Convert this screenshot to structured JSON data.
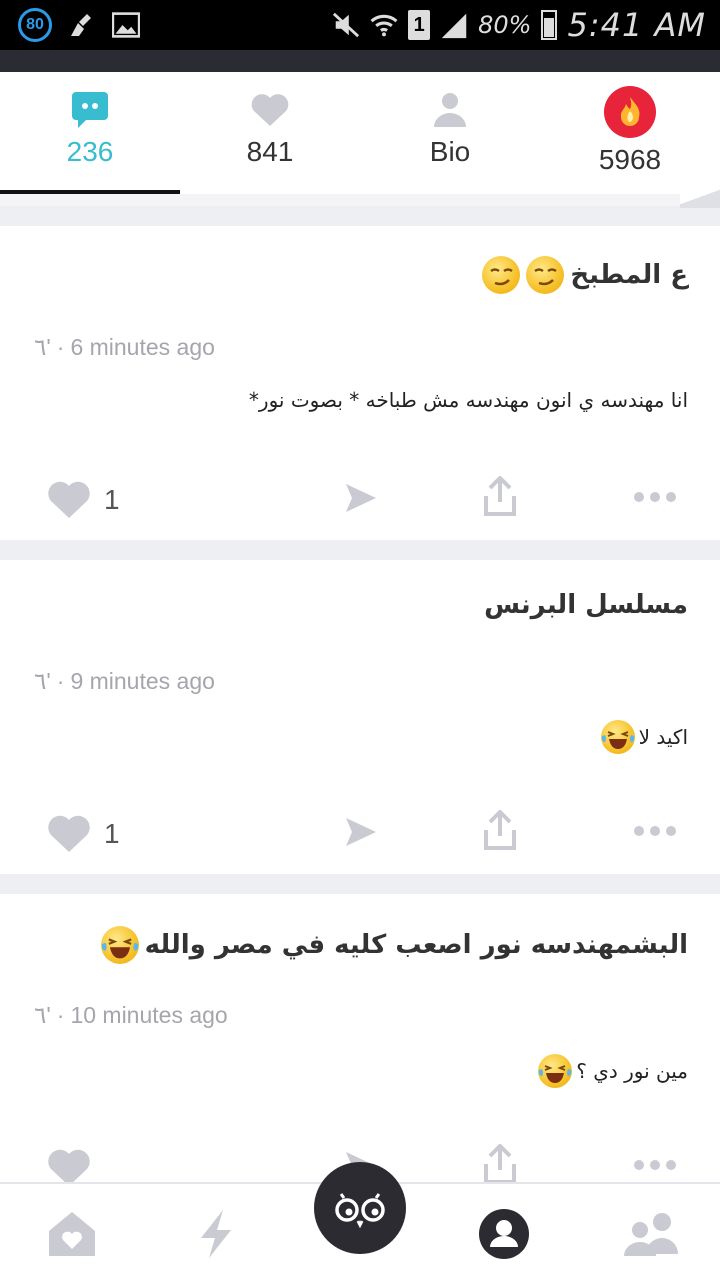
{
  "status_bar": {
    "notification_count": "80",
    "sim_slot": "1",
    "battery": "80%",
    "time": "5:41 AM"
  },
  "tabs": [
    {
      "label": "236",
      "icon": "chat-bubble-icon",
      "active": true
    },
    {
      "label": "841",
      "icon": "heart-icon",
      "active": false
    },
    {
      "label": "Bio",
      "icon": "person-icon",
      "active": false
    },
    {
      "label": "5968",
      "icon": "fire-icon",
      "active": false
    }
  ],
  "posts": [
    {
      "title": "ع المطبخ",
      "author_mark": "٦'",
      "time": "6 minutes ago",
      "body": "انا مهندسه ي انون مهندسه مش طباخه * بصوت نور*",
      "likes": "1"
    },
    {
      "title": "مسلسل البرنس",
      "author_mark": "٦'",
      "time": "9 minutes ago",
      "body": "اكيد لا",
      "likes": "1"
    },
    {
      "title": "البشمهندسه نور اصعب كليه في مصر والله",
      "author_mark": "٦'",
      "time": "10 minutes ago",
      "body": "مين نور دي ؟",
      "likes": ""
    }
  ],
  "bottom_nav": [
    "home-icon",
    "lightning-icon",
    "camera-face-icon",
    "profile-icon",
    "friends-icon"
  ],
  "colors": {
    "accent": "#38bcd0",
    "icon_grey": "#c9cad2",
    "fire": "#e8243a"
  }
}
